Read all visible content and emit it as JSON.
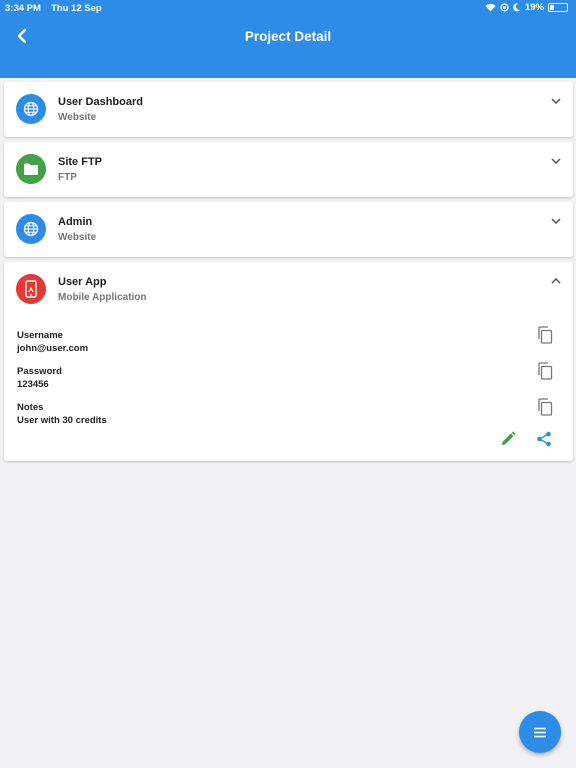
{
  "status_bar": {
    "time": "3:34 PM",
    "date": "Thu 12 Sep",
    "battery": "19%",
    "icons": [
      "wifi-icon",
      "lock-rotation-icon",
      "moon-icon",
      "battery-icon"
    ]
  },
  "header": {
    "title": "Project Detail",
    "back_icon": "chevron-left-icon",
    "color": "#2d8ce8"
  },
  "projects": [
    {
      "title": "User Dashboard",
      "subtitle": "Website",
      "icon": "globe-icon",
      "color": "#2d8ce8",
      "expanded": false
    },
    {
      "title": "Site FTP",
      "subtitle": "FTP",
      "icon": "folder-icon",
      "color": "#43a047",
      "expanded": false
    },
    {
      "title": "Admin",
      "subtitle": "Website",
      "icon": "globe-icon",
      "color": "#2d8ce8",
      "expanded": false
    },
    {
      "title": "User App",
      "subtitle": "Mobile Application",
      "icon": "phone-icon",
      "color": "#e53935",
      "expanded": true
    }
  ],
  "details": {
    "username_label": "Username",
    "username_value": "john@user.com",
    "password_label": "Password",
    "password_value": "123456",
    "notes_label": "Notes",
    "notes_value": "User with 30 credits"
  },
  "actions": {
    "edit_icon": "pencil-icon",
    "edit_color": "#43a047",
    "share_icon": "share-icon",
    "share_color": "#2d8ce8"
  },
  "fab": {
    "icon": "menu-icon"
  }
}
